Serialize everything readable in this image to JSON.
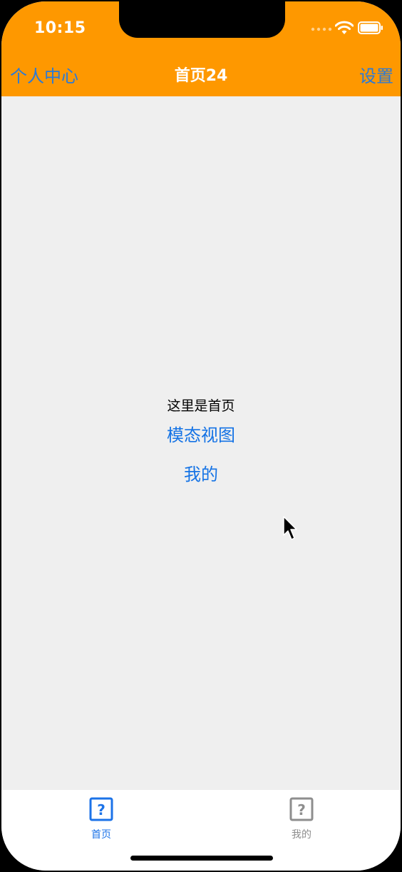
{
  "status_bar": {
    "time": "10:15"
  },
  "nav_bar": {
    "left_button": "个人中心",
    "title": "首页24",
    "right_button": "设置"
  },
  "content": {
    "label": "这里是首页",
    "modal_button": "模态视图",
    "mine_button": "我的"
  },
  "tab_bar": {
    "items": [
      {
        "label": "首页",
        "icon": "question-square-icon",
        "selected": true
      },
      {
        "label": "我的",
        "icon": "question-square-icon",
        "selected": false
      }
    ]
  },
  "colors": {
    "nav_background": "#fe9800",
    "nav_button": "#2a7ad8",
    "link": "#1573e5",
    "content_background": "#efefef",
    "tab_selected": "#1c73e8",
    "tab_unselected": "#8e8e8e"
  }
}
